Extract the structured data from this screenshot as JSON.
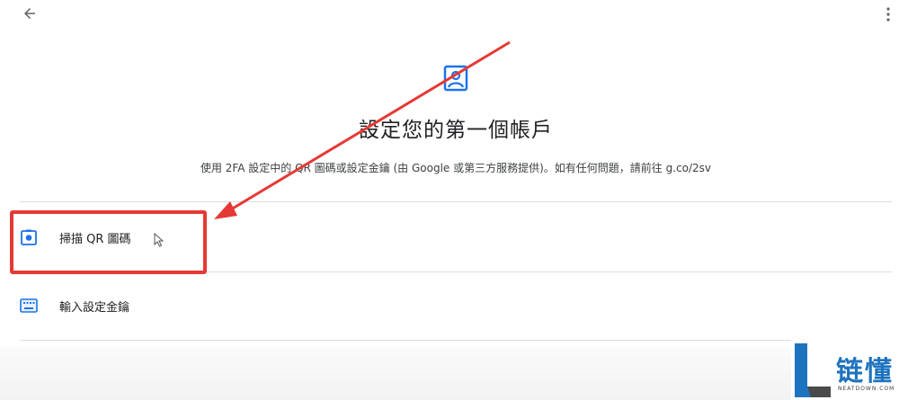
{
  "header": {
    "back_icon": "arrow-left-icon",
    "more_icon": "more-vertical-icon"
  },
  "hero": {
    "icon": "account-box-icon",
    "title": "設定您的第一個帳戶",
    "subtitle": "使用 2FA 設定中的 QR 圖碼或設定金鑰 (由 Google 或第三方服務提供)。如有任何問題，請前往 g.co/2sv"
  },
  "options": [
    {
      "label": "掃描 QR 圖碼",
      "icon": "camera-icon"
    },
    {
      "label": "輸入設定金鑰",
      "icon": "keyboard-icon"
    }
  ],
  "watermark": {
    "name": "链懂",
    "sub": "NEATDOWN.COM"
  },
  "colors": {
    "accent": "#1a73e8",
    "annotation": "#e53935",
    "divider": "#dadce0",
    "watermark": "#1e73be"
  }
}
